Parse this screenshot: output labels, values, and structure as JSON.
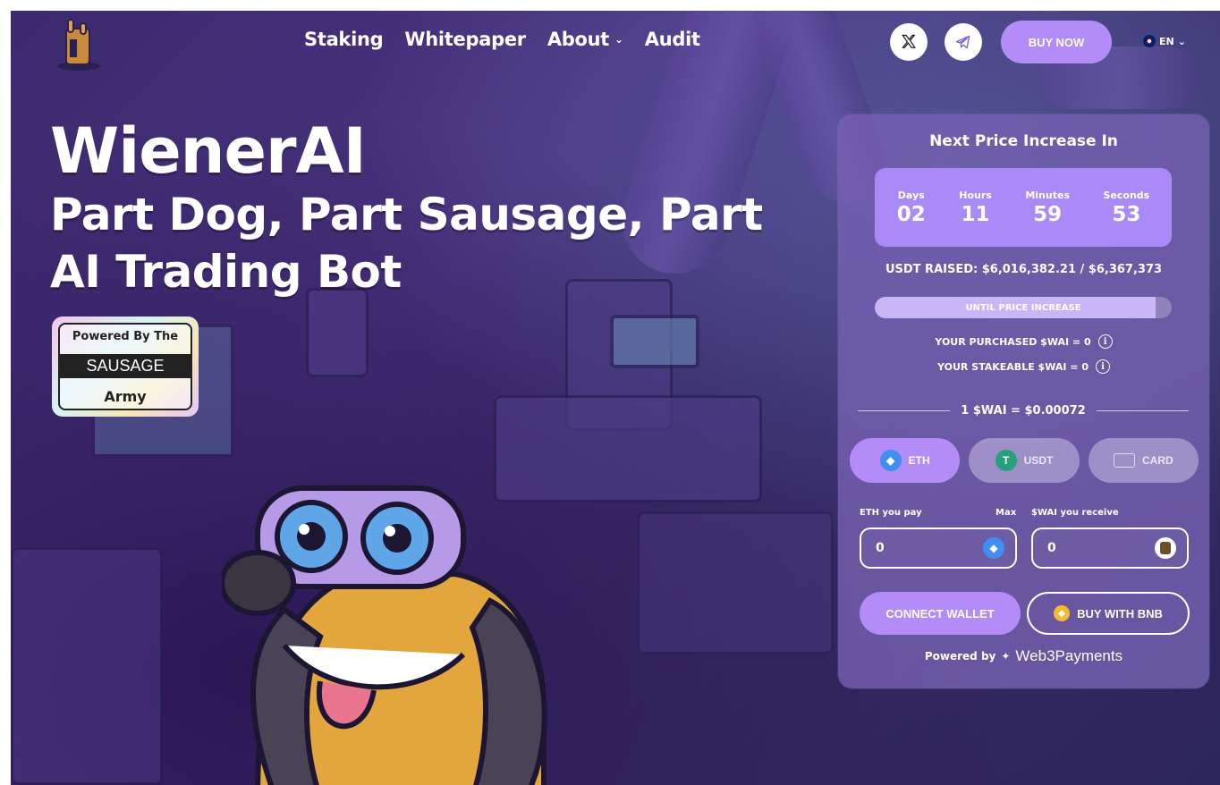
{
  "header": {
    "nav": [
      {
        "label": "Staking"
      },
      {
        "label": "Whitepaper"
      },
      {
        "label": "About"
      },
      {
        "label": "Audit"
      }
    ],
    "buy_now": "BUY NOW",
    "language": "EN",
    "icons": {
      "x": "x-logo-icon",
      "telegram": "telegram-icon"
    }
  },
  "hero": {
    "title": "WienerAI",
    "subtitle": "Part Dog, Part Sausage, Part AI Trading Bot",
    "badge": {
      "top": "Powered By The",
      "middle": "SAUSAGE",
      "bottom": "Army"
    }
  },
  "widget": {
    "title": "Next Price Increase In",
    "countdown": [
      {
        "label": "Days",
        "value": "02"
      },
      {
        "label": "Hours",
        "value": "11"
      },
      {
        "label": "Minutes",
        "value": "59"
      },
      {
        "label": "Seconds",
        "value": "53"
      }
    ],
    "raised": "USDT RAISED: $6,016,382.21 / $6,367,373",
    "progress": {
      "label": "UNTIL PRICE INCREASE",
      "percent": 94.5
    },
    "purchased": "YOUR PURCHASED $WAI = 0",
    "stakeable": "YOUR STAKEABLE $WAI = 0",
    "rate": "1 $WAI = $0.00072",
    "pay_options": [
      {
        "label": "ETH",
        "icon": "ethereum-icon"
      },
      {
        "label": "USDT",
        "icon": "tether-icon"
      },
      {
        "label": "CARD",
        "icon": "card-icon"
      }
    ],
    "pay_label": "ETH you pay",
    "max_label": "Max",
    "receive_label": "$WAI you receive",
    "pay_value": "0",
    "receive_value": "0",
    "connect_wallet": "CONNECT WALLET",
    "buy_bnb": "BUY WITH BNB",
    "powered_prefix": "Powered by",
    "powered_brand": "Web3Payments"
  },
  "colors": {
    "accent": "#b38cf7",
    "panel": "#7460b0",
    "eth": "#3f8ef0",
    "usdt": "#26a17b",
    "bnb": "#f3ba2f"
  }
}
